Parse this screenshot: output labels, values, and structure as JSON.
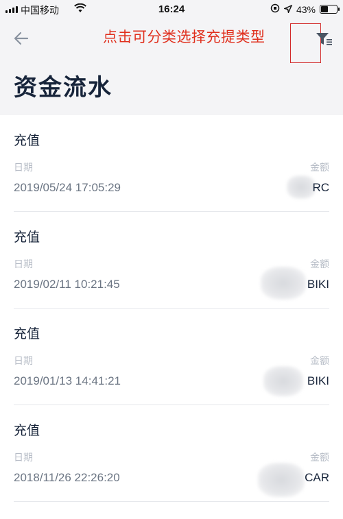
{
  "status_bar": {
    "carrier": "中国移动",
    "time": "16:24",
    "battery_percent": "43%",
    "battery_level": 0.43
  },
  "header": {
    "back_icon": "back-arrow-icon",
    "annotation": "点击可分类选择充提类型",
    "filter_icon": "filter-icon",
    "title": "资金流水"
  },
  "records": [
    {
      "type": "充值",
      "date_label": "日期",
      "amount_label": "金额",
      "date": "2019/05/24 17:05:29",
      "amount": "RC"
    },
    {
      "type": "充值",
      "date_label": "日期",
      "amount_label": "金额",
      "date": "2019/02/11 10:21:45",
      "amount": "BIKI"
    },
    {
      "type": "充值",
      "date_label": "日期",
      "amount_label": "金额",
      "date": "2019/01/13 14:41:21",
      "amount": "BIKI"
    },
    {
      "type": "充值",
      "date_label": "日期",
      "amount_label": "金额",
      "date": "2018/11/26 22:26:20",
      "amount": "CAR"
    }
  ],
  "colors": {
    "annotation": "#e0301e",
    "header_bg": "#f4f4f6",
    "title": "#17243a"
  }
}
